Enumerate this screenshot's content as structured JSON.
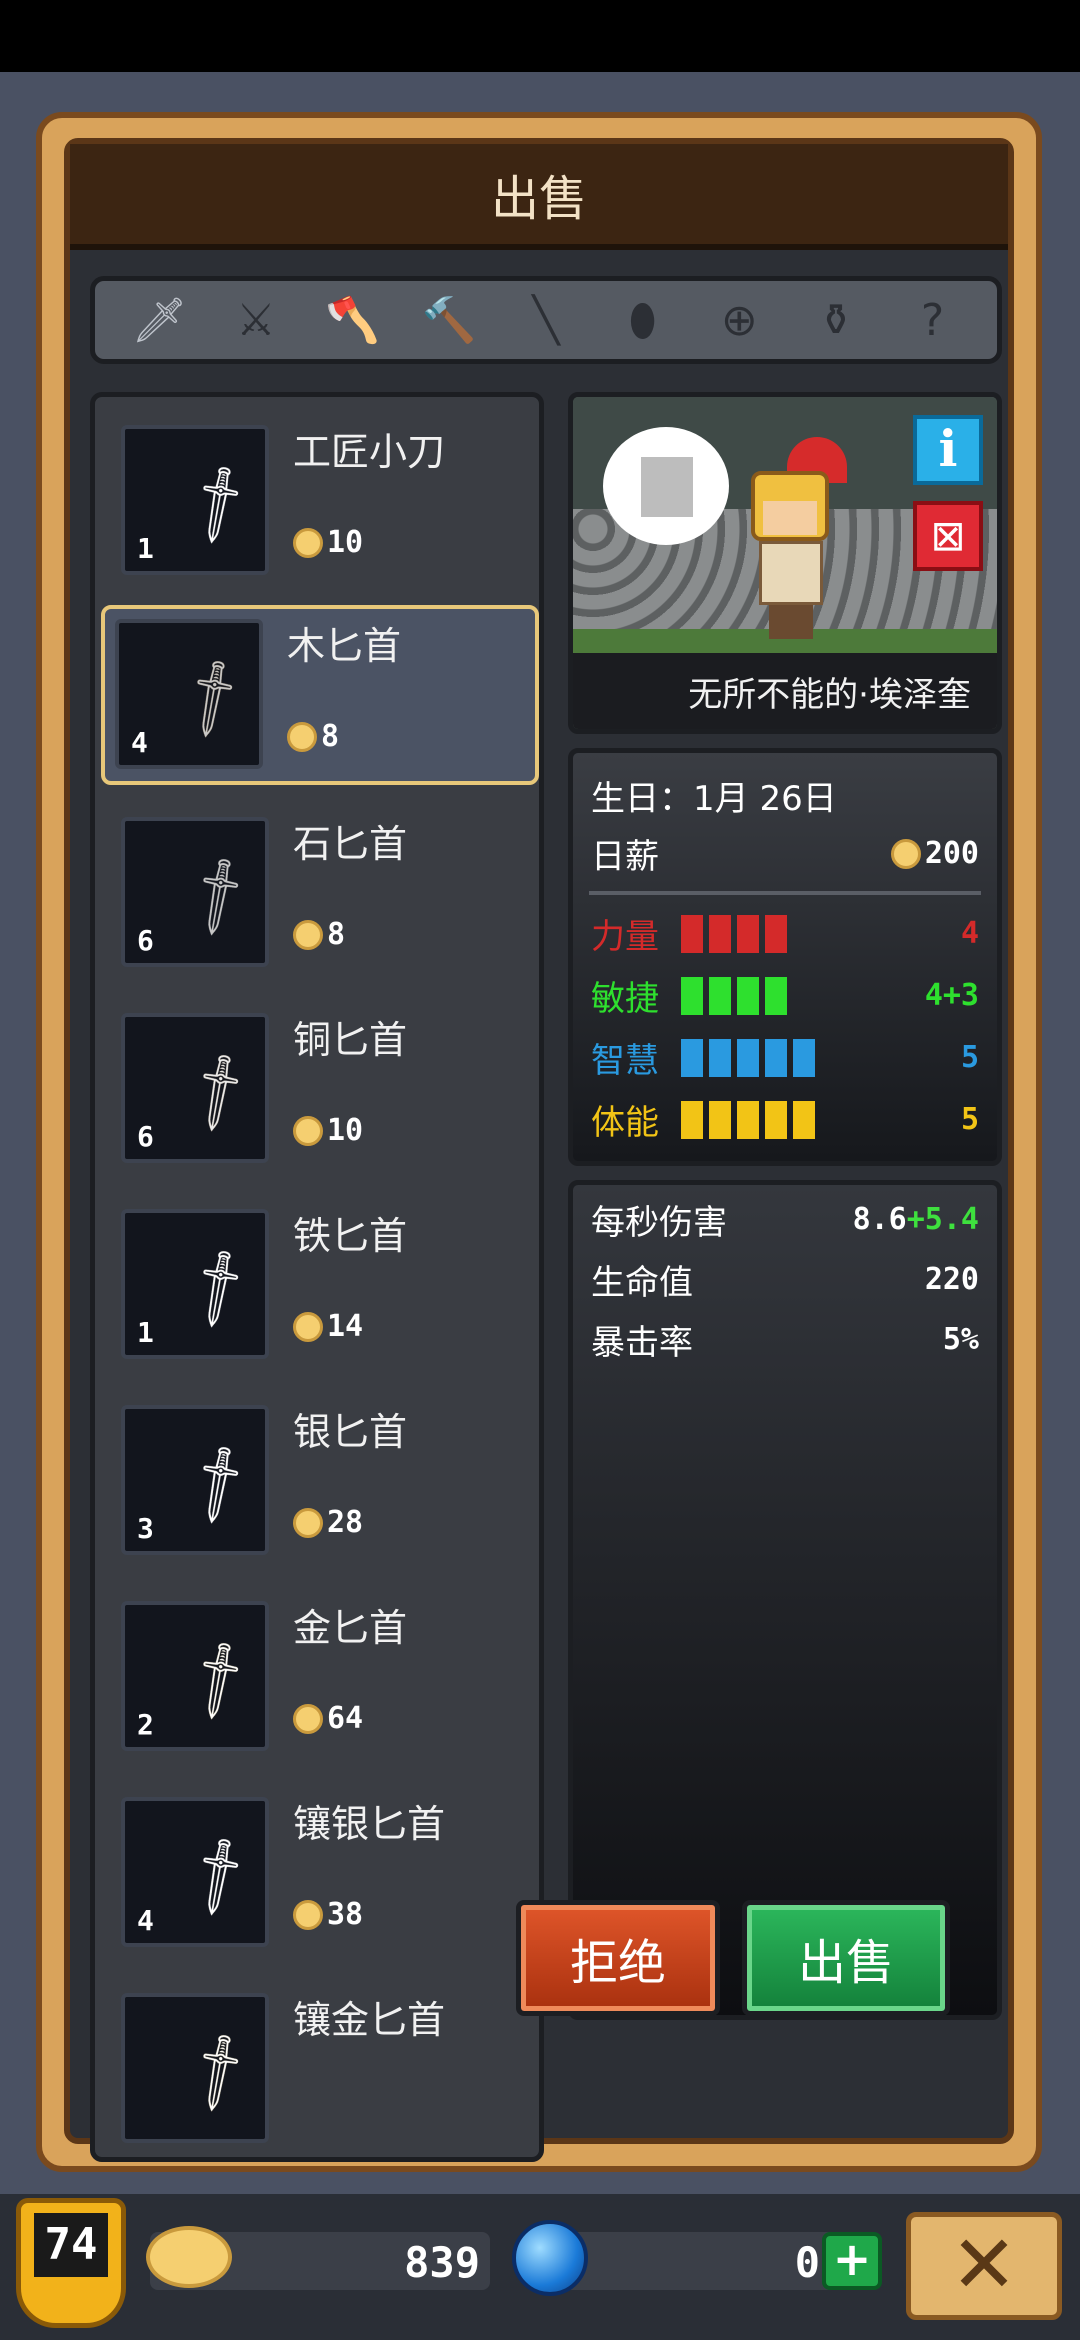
{
  "title": "出售",
  "tabs": [
    {
      "name": "dagger",
      "glyph": "🗡",
      "active": true
    },
    {
      "name": "sword",
      "glyph": "⚔",
      "active": false
    },
    {
      "name": "axe",
      "glyph": "🪓",
      "active": false
    },
    {
      "name": "hammer",
      "glyph": "🔨",
      "active": false
    },
    {
      "name": "spear",
      "glyph": "╲",
      "active": false
    },
    {
      "name": "shield",
      "glyph": "⬮",
      "active": false
    },
    {
      "name": "bow",
      "glyph": "⊕",
      "active": false
    },
    {
      "name": "potion",
      "glyph": "⚱",
      "active": false
    },
    {
      "name": "unknown",
      "glyph": "?",
      "active": false
    }
  ],
  "items": [
    {
      "name": "工匠小刀",
      "qty": "1",
      "price": "10",
      "color": "#d9d9d9"
    },
    {
      "name": "木匕首",
      "qty": "4",
      "price": "8",
      "color": "#c8892a"
    },
    {
      "name": "石匕首",
      "qty": "6",
      "price": "8",
      "color": "#8e8e8e"
    },
    {
      "name": "铜匕首",
      "qty": "6",
      "price": "10",
      "color": "#d7a15a"
    },
    {
      "name": "铁匕首",
      "qty": "1",
      "price": "14",
      "color": "#c4c4c4"
    },
    {
      "name": "银匕首",
      "qty": "3",
      "price": "28",
      "color": "#ededed"
    },
    {
      "name": "金匕首",
      "qty": "2",
      "price": "64",
      "color": "#e0b43a"
    },
    {
      "name": "镶银匕首",
      "qty": "4",
      "price": "38",
      "color": "#e6e6e6"
    },
    {
      "name": "镶金匕首",
      "qty": "",
      "price": "",
      "color": "#e0b43a"
    }
  ],
  "selected_index": 1,
  "hero": {
    "name": "无所不能的·埃泽奎",
    "birthday_label": "生日：",
    "birthday_value": "1月 26日",
    "salary_label": "日薪",
    "salary_value": "200"
  },
  "stats": [
    {
      "label": "力量",
      "value": "4",
      "color": "#d42a2a",
      "bars": 4
    },
    {
      "label": "敏捷",
      "value": "4+3",
      "color": "#2ee02e",
      "bars": 4
    },
    {
      "label": "智慧",
      "value": "5",
      "color": "#2a9ae0",
      "bars": 5
    },
    {
      "label": "体能",
      "value": "5",
      "color": "#f2c416",
      "bars": 5
    }
  ],
  "derived": {
    "dps_label": "每秒伤害",
    "dps_base": "8.6",
    "dps_bonus": "+5.4",
    "hp_label": "生命值",
    "hp_value": "220",
    "crit_label": "暴击率",
    "crit_value": "5%"
  },
  "buttons": {
    "reject": "拒绝",
    "sell": "出售"
  },
  "bottom": {
    "level": "74",
    "gold": "839",
    "gems": "0",
    "plus": "+",
    "close": "✕"
  },
  "colors": {
    "bonus": "#3ee03e",
    "panel_frame": "#d9a35b",
    "reject": "#c4431c",
    "sell": "#1f9c4a"
  }
}
